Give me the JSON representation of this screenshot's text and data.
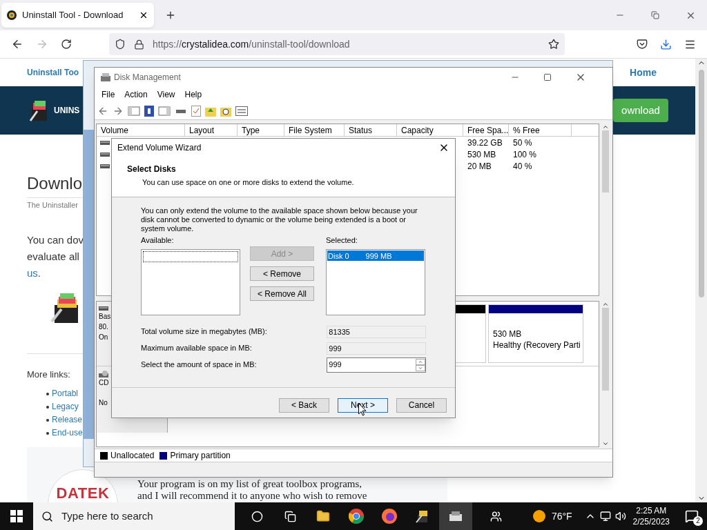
{
  "browser": {
    "tab_title": "Uninstall Tool - Download",
    "url_host": "https://crystalidea.com",
    "url_path": "/uninstall-tool/download"
  },
  "webpage": {
    "nav_items": [
      "Uninstall Too",
      "Home"
    ],
    "banner_text": "UNINS",
    "download_button": "ownload",
    "heading": "Downlo",
    "subtitle": "The Uninstaller",
    "intro_lines": [
      "You can dov",
      "evaluate all"
    ],
    "intro_link": "us",
    "intro_end": ".",
    "more_links_title": "More links:",
    "links": [
      "Portabl",
      "Legacy",
      "Release",
      "End-use"
    ],
    "logo_text": "DATEK",
    "testimonial_lines": [
      "Your program is on my list of great toolbox programs,",
      "and I will recommend it to anyone who wish to remove"
    ]
  },
  "disk_management": {
    "title": "Disk Management",
    "menu": [
      "File",
      "Action",
      "View",
      "Help"
    ],
    "columns": [
      "Volume",
      "Layout",
      "Type",
      "File System",
      "Status",
      "Capacity",
      "Free Spa...",
      "% Free"
    ],
    "rows": [
      {
        "free_space": "39.22 GB",
        "percent_free": "50 %"
      },
      {
        "free_space": "530 MB",
        "percent_free": "100 %"
      },
      {
        "free_space": "20 MB",
        "percent_free": "40 %"
      }
    ],
    "disk_labels": [
      "Bas",
      "80.",
      "On"
    ],
    "cd_labels": [
      "CD",
      "No"
    ],
    "partition": {
      "size": "530 MB",
      "status": "Healthy (Recovery Parti"
    },
    "legend": [
      {
        "label": "Unallocated",
        "color": "#000000"
      },
      {
        "label": "Primary partition",
        "color": "#000080"
      }
    ]
  },
  "wizard": {
    "title": "Extend Volume Wizard",
    "heading": "Select Disks",
    "subheading": "You can use space on one or more disks to extend the volume.",
    "note": "You can only extend the volume to the available space shown below because your disk cannot be converted to dynamic or the volume being extended is a boot or system volume.",
    "available_label": "Available:",
    "selected_label": "Selected:",
    "move_buttons": [
      {
        "label": "Add >",
        "disabled": true
      },
      {
        "label": "< Remove",
        "disabled": false
      },
      {
        "label": "< Remove All",
        "disabled": false
      }
    ],
    "selected_items": [
      {
        "disk": "Disk 0",
        "size": "999 MB",
        "selected": true
      }
    ],
    "fields": [
      {
        "kind": "readonly",
        "label": "Total volume size in megabytes (MB):",
        "value": "81335"
      },
      {
        "kind": "readonly",
        "label": "Maximum available space in MB:",
        "value": "999"
      },
      {
        "kind": "spinner",
        "label": "Select the amount of space in MB:",
        "value": "999"
      }
    ],
    "footer_buttons": [
      {
        "label": "< Back",
        "focused": false
      },
      {
        "label": "Next >",
        "focused": true
      },
      {
        "label": "Cancel",
        "focused": false
      }
    ]
  },
  "taskbar": {
    "search_placeholder": "Type here to search",
    "weather": "76°F",
    "time": "2:25 AM",
    "date": "2/25/2023",
    "notifications": "2"
  }
}
